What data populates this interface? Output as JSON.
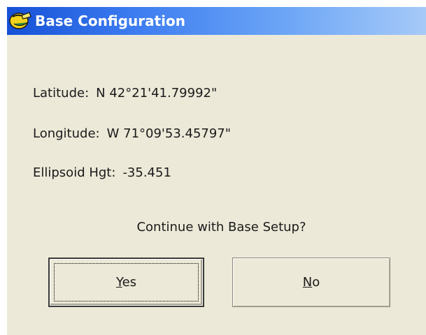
{
  "window": {
    "title": "Base Configuration",
    "icon": "satellite-dish-icon"
  },
  "info": {
    "latitude_label": "Latitude:",
    "latitude_value": "N 42°21'41.79992\"",
    "longitude_label": "Longitude:",
    "longitude_value": "W 71°09'53.45797\"",
    "ellipsoid_label": "Ellipsoid Hgt:",
    "ellipsoid_value": "-35.451"
  },
  "prompt": "Continue with Base Setup?",
  "buttons": {
    "yes_first": "Y",
    "yes_rest": "es",
    "no_first": "N",
    "no_rest": "o"
  },
  "colors": {
    "titlebar_start": "#1550d6",
    "titlebar_end": "#a6caf8",
    "dialog_bg": "#ece9d8"
  }
}
